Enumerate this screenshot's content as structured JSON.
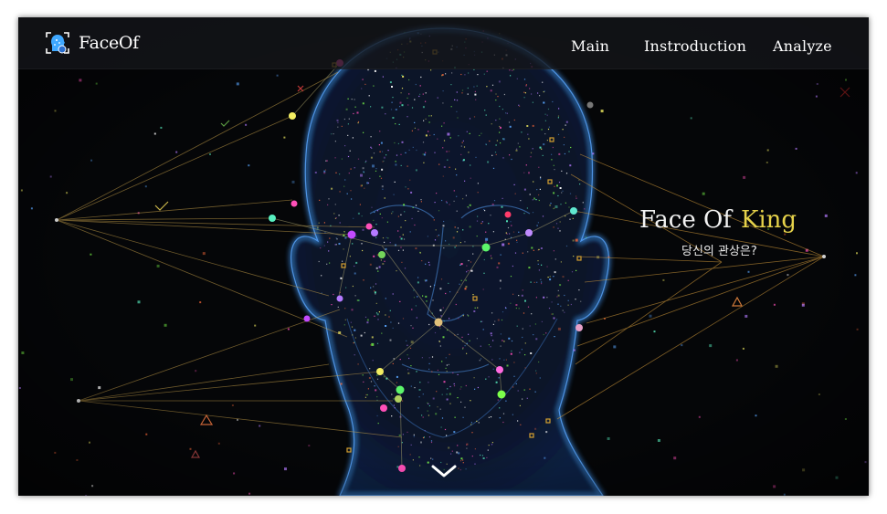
{
  "header": {
    "logo_text": "FaceOf",
    "logo_icon": "face-scan-icon",
    "nav": [
      {
        "label": "Main"
      },
      {
        "label": "Instroduction"
      },
      {
        "label": "Analyze"
      }
    ]
  },
  "hero": {
    "title_part1": "Face Of",
    "title_part2": "King",
    "subtitle": "당신의 관상은?",
    "scroll_icon": "chevron-down-icon"
  },
  "colors": {
    "background": "#050608",
    "accent": "#e6d24a",
    "head_glow": "#3a86d8",
    "line_gold": "#c99a3a",
    "navbar": "#14161a"
  }
}
